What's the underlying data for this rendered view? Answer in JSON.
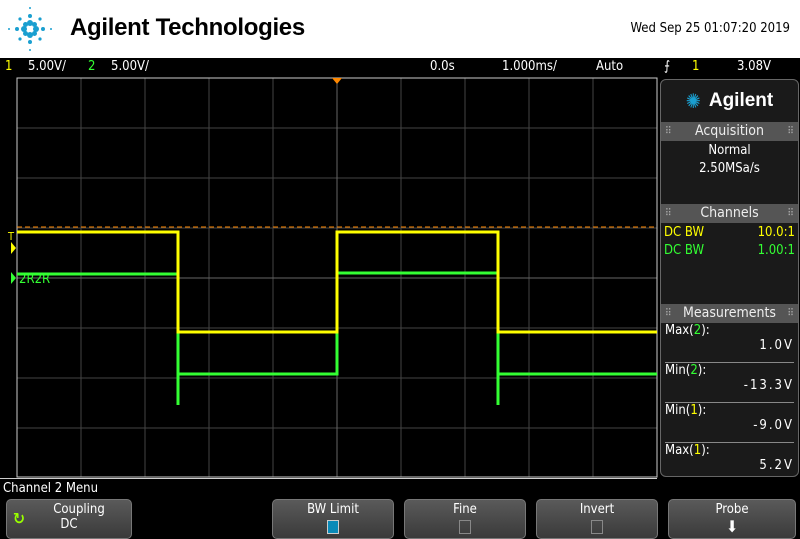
{
  "header": {
    "brand": "Agilent Technologies",
    "datetime": "Wed Sep 25 01:07:20 2019"
  },
  "status": {
    "ch1_num": "1",
    "ch1_scale": "5.00V/",
    "ch2_num": "2",
    "ch2_scale": "5.00V/",
    "time_delay": "0.0s",
    "time_scale": "1.000ms/",
    "trigger_mode": "Auto",
    "trigger_edge_icon": "rising-edge-icon",
    "trigger_source": "1",
    "trigger_level": "3.08V"
  },
  "screen": {
    "ch2_label": "2R2R",
    "trigger_marker": "T",
    "colors": {
      "ch1": "#ffff00",
      "ch2": "#33ff33",
      "trigger": "#ff8800"
    }
  },
  "panel": {
    "brand": "Agilent",
    "acquisition": {
      "title": "Acquisition",
      "mode": "Normal",
      "rate": "2.50MSa/s"
    },
    "channels": {
      "title": "Channels",
      "rows": [
        {
          "coupling": "DC BW",
          "probe": "10.0:1"
        },
        {
          "coupling": "DC BW",
          "probe": "1.00:1"
        }
      ]
    },
    "measurements": {
      "title": "Measurements",
      "items": [
        {
          "name": "Max(",
          "ch": "2",
          "end": "):",
          "value": "1.0V"
        },
        {
          "name": "Min(",
          "ch": "2",
          "end": "):",
          "value": "-13.3V"
        },
        {
          "name": "Min(",
          "ch": "1",
          "end": "):",
          "value": "-9.0V"
        },
        {
          "name": "Max(",
          "ch": "1",
          "end": "):",
          "value": "5.2V"
        }
      ]
    }
  },
  "menu": {
    "title": "Channel 2 Menu",
    "coupling_label": "Coupling",
    "coupling_value": "DC",
    "bw_limit": "BW Limit",
    "bw_limit_on": true,
    "fine": "Fine",
    "fine_on": false,
    "invert": "Invert",
    "invert_on": false,
    "probe": "Probe"
  }
}
